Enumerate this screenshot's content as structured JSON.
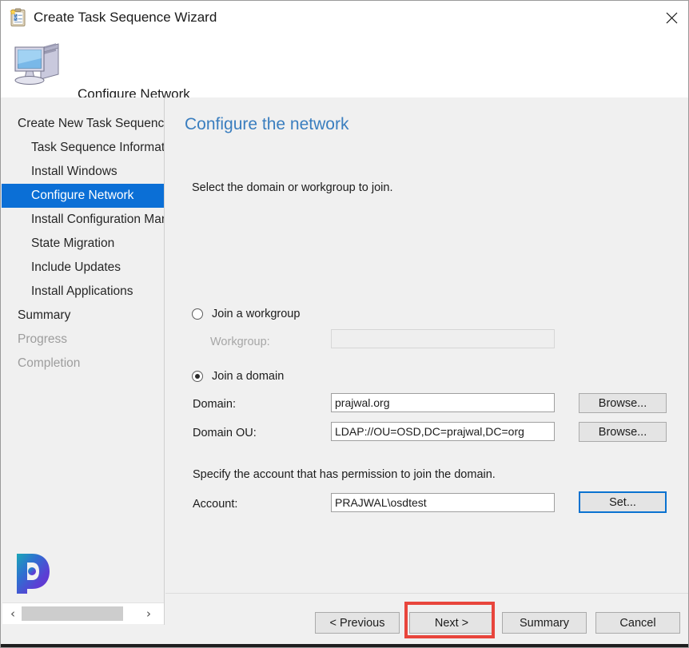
{
  "window": {
    "title": "Create Task Sequence Wizard",
    "title_icon": "task-sequence-clipboard-icon",
    "close_label": "✕",
    "header_title": "Configure Network",
    "header_icon": "computer-icon"
  },
  "sidebar": {
    "items": [
      {
        "label": "Create New Task Sequence",
        "state": "normal",
        "indent": false
      },
      {
        "label": "Task Sequence Informatio",
        "state": "normal",
        "indent": true
      },
      {
        "label": "Install Windows",
        "state": "normal",
        "indent": true
      },
      {
        "label": "Configure Network",
        "state": "selected",
        "indent": true
      },
      {
        "label": "Install Configuration Mar",
        "state": "normal",
        "indent": true
      },
      {
        "label": "State Migration",
        "state": "normal",
        "indent": true
      },
      {
        "label": "Include Updates",
        "state": "normal",
        "indent": true
      },
      {
        "label": "Install Applications",
        "state": "normal",
        "indent": true
      },
      {
        "label": "Summary",
        "state": "normal",
        "indent": false
      },
      {
        "label": "Progress",
        "state": "disabled",
        "indent": false
      },
      {
        "label": "Completion",
        "state": "disabled",
        "indent": false
      }
    ],
    "scrollbar": {
      "left_arrow": "‹",
      "right_arrow": "›"
    },
    "logo": "prajwal-p-logo"
  },
  "main": {
    "page_title": "Configure the network",
    "intro_text": "Select the domain or workgroup to join.",
    "workgroup_option": {
      "label": "Join a workgroup",
      "selected": false,
      "field_label": "Workgroup:",
      "field_value": "",
      "field_disabled": true
    },
    "domain_option": {
      "label": "Join a domain",
      "selected": true,
      "domain_label": "Domain:",
      "domain_value": "prajwal.org",
      "domain_browse": "Browse...",
      "ou_label": "Domain OU:",
      "ou_value": "LDAP://OU=OSD,DC=prajwal,DC=org",
      "ou_browse": "Browse..."
    },
    "account_section": {
      "description": "Specify the account that has permission to join the domain.",
      "label": "Account:",
      "value": "PRAJWAL\\osdtest",
      "set_button": "Set..."
    }
  },
  "footer": {
    "previous": "< Previous",
    "next": "Next >",
    "summary": "Summary",
    "cancel": "Cancel"
  },
  "colors": {
    "accent_blue": "#0b6fd6",
    "title_blue": "#3a7ebf",
    "focus_blue": "#0a72d0",
    "highlight_red": "#e8453c",
    "window_bg": "#f0f0f0"
  }
}
